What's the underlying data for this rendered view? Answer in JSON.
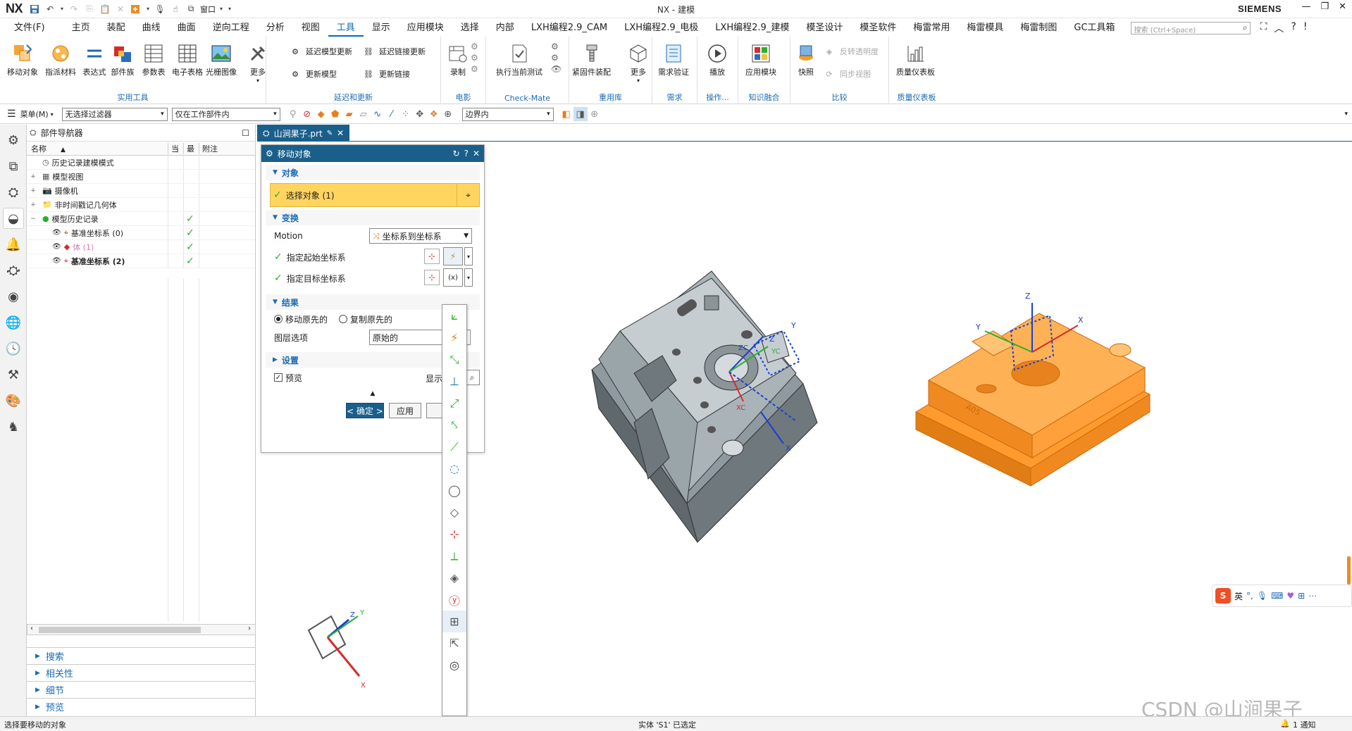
{
  "app": {
    "logo": "NX",
    "window_title": "NX - 建模",
    "brand": "SIEMENS",
    "accent": "#1a5f8a",
    "model_color": "#ff9a2e",
    "qat_icons": [
      "save-icon",
      "undo-icon",
      "redo-icon",
      "copy-icon",
      "paste-icon",
      "delete-icon",
      "command-finder-icon",
      "microphone-icon",
      "touch-mode-icon",
      "window-icon"
    ],
    "qat_window_label": "窗口"
  },
  "menu": {
    "file": "文件(F)",
    "items": [
      "主页",
      "装配",
      "曲线",
      "曲面",
      "逆向工程",
      "分析",
      "视图",
      "工具",
      "显示",
      "应用模块",
      "选择",
      "内部",
      "LXH编程2.9_CAM",
      "LXH编程2.9_电极",
      "LXH编程2.9_建模",
      "模圣设计",
      "模圣软件",
      "梅雷常用",
      "梅雷模具",
      "梅雷制图",
      "GC工具箱"
    ],
    "active_index": 7,
    "search_placeholder": "搜索 (Ctrl+Space)"
  },
  "ribbon": {
    "utility": {
      "buttons": [
        "移动对象",
        "指派材料",
        "表达式",
        "部件族",
        "参数表",
        "电子表格",
        "光栅图像",
        "更多"
      ],
      "group_label": "实用工具"
    },
    "update": {
      "items": [
        "延迟模型更新",
        "延迟链接更新",
        "更新模型",
        "更新链接"
      ],
      "group_label": "延迟和更新"
    },
    "movie": {
      "buttons": [
        "录制"
      ],
      "group_label": "电影"
    },
    "checkmate": {
      "buttons": [
        "执行当前测试"
      ],
      "group_label": "Check-Mate"
    },
    "reuse": {
      "buttons": [
        "紧固件装配",
        "更多"
      ],
      "group_label": "重用库"
    },
    "requirements": {
      "buttons": [
        "需求验证"
      ],
      "group_label": "需求"
    },
    "operation": {
      "buttons": [
        "播放"
      ],
      "group_label": "操作..."
    },
    "knowledge": {
      "buttons": [
        "应用模块"
      ],
      "group_label": "知识融合"
    },
    "compare": {
      "buttons": [
        "快照"
      ],
      "items": [
        "反转透明度",
        "同步视图"
      ],
      "group_label": "比较"
    },
    "quality": {
      "buttons": [
        "质量仪表板"
      ],
      "group_label": "质量仪表板"
    }
  },
  "toolbar2": {
    "menu_label": "菜单(M)",
    "filter": "无选择过滤器",
    "scope": "仅在工作部件内",
    "snap": "边界内"
  },
  "part_navigator": {
    "title": "部件导航器",
    "columns": [
      "名称",
      "当",
      "最",
      "附注"
    ],
    "rows": [
      {
        "label": "历史记录建模模式",
        "indent": 0,
        "check": false
      },
      {
        "label": "模型视图",
        "indent": 0,
        "check": false
      },
      {
        "label": "摄像机",
        "indent": 0,
        "check": false
      },
      {
        "label": "非时间戳记几何体",
        "indent": 0,
        "check": false
      },
      {
        "label": "模型历史记录",
        "indent": 0,
        "check": true
      },
      {
        "label": "基准坐标系 (0)",
        "indent": 1,
        "check": true
      },
      {
        "label": "体 (1)",
        "indent": 1,
        "check": true
      },
      {
        "label": "基准坐标系 (2)",
        "indent": 1,
        "check": true
      }
    ],
    "panels": [
      "搜索",
      "相关性",
      "细节",
      "预览"
    ]
  },
  "tab": {
    "label": "山涧果子.prt"
  },
  "dialog": {
    "title": "移动对象",
    "object_section": "对象",
    "select_object": "选择对象 (1)",
    "transform_section": "变换",
    "motion_label": "Motion",
    "motion_value": "坐标系到坐标系",
    "from_csys": "指定起始坐标系",
    "to_csys": "指定目标坐标系",
    "result_section": "结果",
    "radio_move": "移动原先的",
    "radio_copy": "复制原先的",
    "layer_label": "图层选项",
    "layer_value": "原始的",
    "settings_section": "设置",
    "preview_label": "预览",
    "show_label": "显示",
    "ok": "< 确定 >",
    "apply": "应用"
  },
  "flyout": {
    "icons": [
      "csys-dynamic-icon",
      "csys-inferred-icon",
      "csys-origin-x-y-icon",
      "csys-x-y-origin-icon",
      "csys-z-x-origin-icon",
      "csys-z-y-origin-icon",
      "csys-plane-x-axis-icon",
      "csys-plane-axis-icon",
      "csys-plane-plane-icon",
      "csys-three-planes-icon",
      "csys-absolute-icon",
      "csys-current-view-icon",
      "csys-offset-icon",
      "csys-wcs-icon",
      "csys-expression-icon",
      "csys-transform-icon",
      "csys-display-icon"
    ]
  },
  "viewport": {
    "triad_labels": [
      "Z",
      "Y",
      "X",
      "ZC",
      "YC",
      "XC"
    ],
    "orange_labels": [
      "Z",
      "Y",
      "X"
    ],
    "view_triad_labels": [
      "Z",
      "Y",
      "X"
    ]
  },
  "status": {
    "left": "选择要移动的对象",
    "center": "实体 'S1' 已选定",
    "right": "1 通知"
  },
  "ime": {
    "label": "英"
  },
  "watermark": "CSDN @山涧果子"
}
